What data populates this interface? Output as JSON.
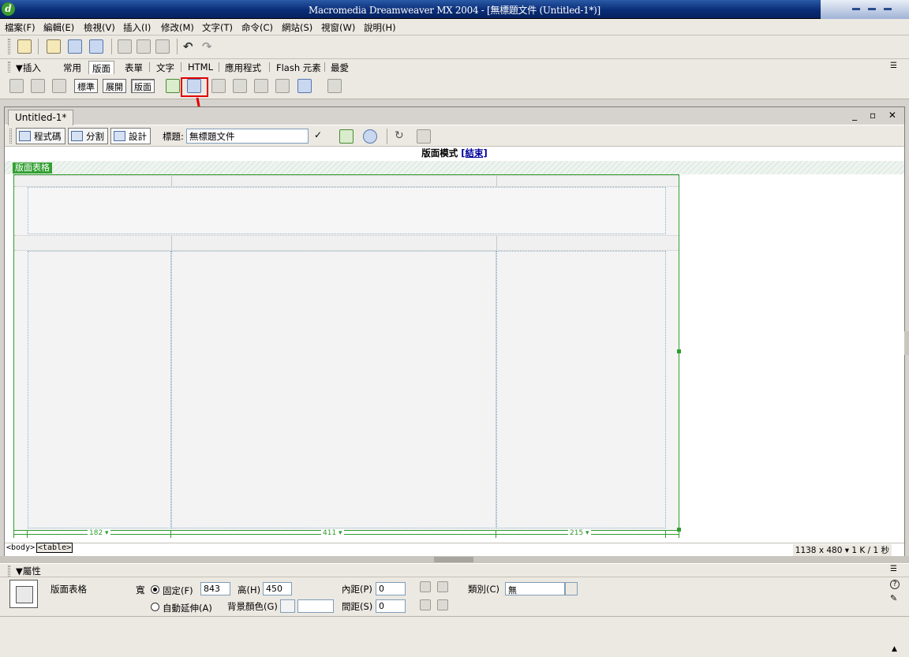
{
  "window": {
    "title": "Macromedia Dreamweaver MX 2004 - [無標題文件 (Untitled-1*)]"
  },
  "menu": [
    "檔案(F)",
    "編輯(E)",
    "檢視(V)",
    "插入(I)",
    "修改(M)",
    "文字(T)",
    "命令(C)",
    "網站(S)",
    "視窗(W)",
    "說明(H)"
  ],
  "insert_bar": {
    "label": "▼插入",
    "tabs": [
      "常用",
      "版面",
      "表單",
      "文字",
      "HTML",
      "應用程式",
      "Flash 元素",
      "最愛"
    ],
    "selected_tab": "版面",
    "modes": [
      "標準",
      "展開",
      "版面"
    ]
  },
  "document": {
    "tab": "Untitled-1*",
    "window_controls": "_ ▫ ✕",
    "views": [
      "程式碼",
      "分割",
      "設計"
    ],
    "title_label": "標題:",
    "title_value": "無標題文件",
    "mode_label": "版面模式",
    "mode_exit": "[結束]",
    "layout_table_tab": "版面表格",
    "column_widths": [
      "182 ▾",
      "411 ▾",
      "215 ▾"
    ]
  },
  "status": {
    "tag_body": "<body>",
    "tag_table": "<table>",
    "size": "1138 x 480 ▾ 1 K / 1 秒"
  },
  "properties": {
    "header": "▼屬性",
    "kind": "版面表格",
    "width_label": "寬",
    "fixed_label": "固定(F)",
    "width_value": "843",
    "height_label": "高(H)",
    "height_value": "450",
    "auto_label": "自動延伸(A)",
    "bgcolor_label": "背景顏色(G)",
    "padding_label": "內距(P)",
    "padding_value": "0",
    "spacing_label": "間距(S)",
    "spacing_value": "0",
    "class_label": "類別(C)",
    "class_value": "無",
    "help": "?"
  },
  "icons": [
    "new-file-icon",
    "open-folder-icon",
    "save-icon",
    "save-all-icon",
    "cut-icon",
    "copy-icon",
    "paste-icon",
    "undo-icon",
    "redo-icon",
    "draw-layout-cell-icon",
    "draw-layout-table-icon",
    "preview-globe-icon",
    "refresh-icon",
    "view-options-icon"
  ],
  "colors": {
    "accent_highlight": "#e00000",
    "layout_green": "#2f9c2f",
    "title_blue": "#0a2d78"
  }
}
